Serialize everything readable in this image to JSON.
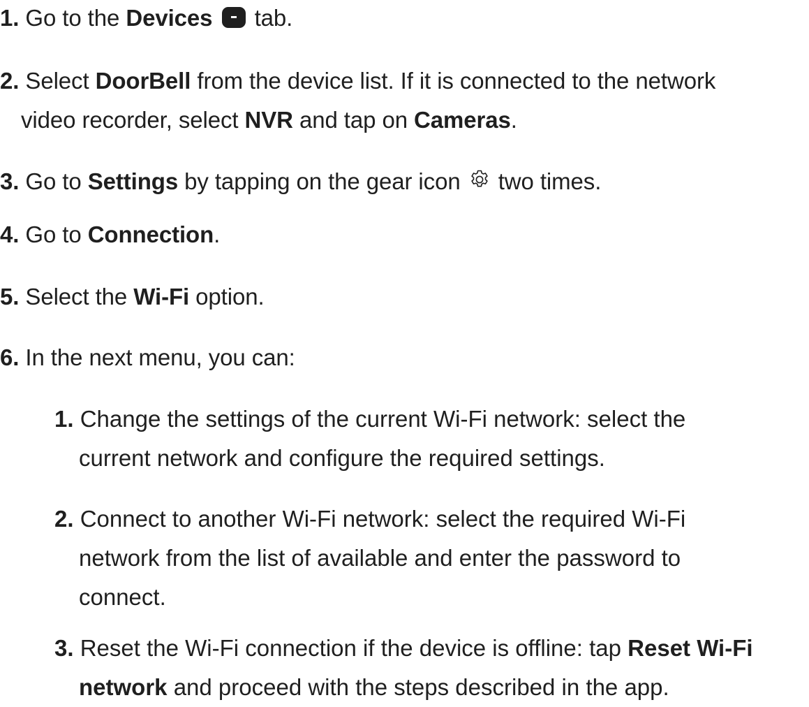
{
  "steps": [
    {
      "num": "1.",
      "pre": "Go to the ",
      "b1": "Devices",
      "post": " tab.",
      "icon": "devices-tab-icon"
    },
    {
      "num": "2.",
      "pre": "Select ",
      "b1": "DoorBell",
      "mid": " from the device list. If it is connected to the network",
      "line2_pre": "video recorder, select ",
      "b2": "NVR",
      "line2_mid": " and tap on ",
      "b3": "Cameras",
      "line2_post": "."
    },
    {
      "num": "3.",
      "pre": "Go to ",
      "b1": "Settings",
      "mid": " by tapping on the gear icon ",
      "post": " two times.",
      "icon": "gear-icon"
    },
    {
      "num": "4.",
      "pre": "Go to ",
      "b1": "Connection",
      "post": "."
    },
    {
      "num": "5.",
      "pre": "Select the ",
      "b1": "Wi-Fi",
      "post": " option."
    },
    {
      "num": "6.",
      "text": "In the next menu, you can:"
    }
  ],
  "substeps": [
    {
      "num": "1.",
      "line1": "Change the settings of the current Wi-Fi network: select the",
      "line2": "current network and configure the required settings."
    },
    {
      "num": "2.",
      "line1": "Connect to another Wi-Fi network: select the required Wi-Fi",
      "line2": "network from the list of available and enter the password to",
      "line3": "connect."
    },
    {
      "num": "3.",
      "line1_pre": "Reset the Wi-Fi connection if the device is offline: tap ",
      "b1": "Reset Wi-Fi",
      "b2": "network",
      "line2_post": " and proceed with the steps described in the app."
    }
  ]
}
